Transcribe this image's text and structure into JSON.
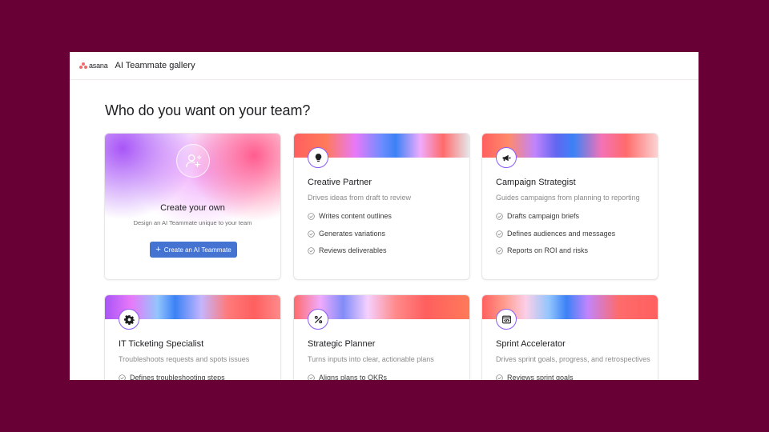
{
  "app": {
    "logo_text": "asana",
    "page": "AI Teammate gallery"
  },
  "heading": "Who do you want on your team?",
  "create_card": {
    "title": "Create your own",
    "subtitle": "Design an AI Teammate unique to your team",
    "button_label": "Create an AI Teammate",
    "icon": "user-plus-icon"
  },
  "cards": [
    {
      "title": "Creative Partner",
      "subtitle": "Drives ideas from draft to review",
      "icon": "lightbulb-icon",
      "features": [
        "Writes content outlines",
        "Generates variations",
        "Reviews deliverables"
      ]
    },
    {
      "title": "Campaign Strategist",
      "subtitle": "Guides campaigns from planning to reporting",
      "icon": "megaphone-icon",
      "features": [
        "Drafts campaign briefs",
        "Defines audiences and messages",
        "Reports on ROI and risks"
      ]
    },
    {
      "title": "IT Ticketing Specialist",
      "subtitle": "Troubleshoots requests and spots issues",
      "icon": "gear-icon",
      "features": [
        "Defines troubleshooting steps"
      ]
    },
    {
      "title": "Strategic Planner",
      "subtitle": "Turns inputs into clear, actionable plans",
      "icon": "percent-icon",
      "features": [
        "Aligns plans to OKRs"
      ]
    },
    {
      "title": "Sprint Accelerator",
      "subtitle": "Drives sprint goals, progress, and retrospectives",
      "icon": "code-window-icon",
      "features": [
        "Reviews sprint goals"
      ]
    }
  ],
  "colors": {
    "background": "#690035",
    "accent": "#4573d2",
    "logo": "#f06a6a",
    "icon_ring": "#8b5cf6"
  }
}
